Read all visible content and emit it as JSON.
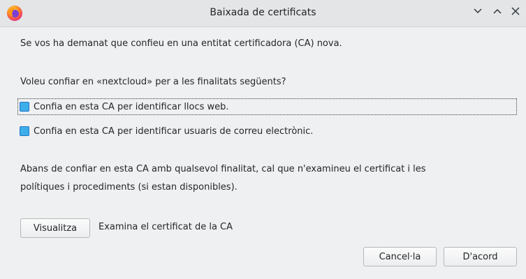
{
  "window": {
    "title": "Baixada de certificats",
    "icon": "firefox-icon",
    "controls": [
      "chevron-down-icon",
      "chevron-up-icon",
      "close-icon"
    ]
  },
  "dialog": {
    "intro": "Se vos ha demanat que confieu en una entitat certificadora (CA) nova.",
    "question": "Voleu confiar en «nextcloud» per a les finalitats següents?",
    "checkboxes": [
      {
        "label": "Confia en esta CA per identificar llocs web.",
        "checked": true
      },
      {
        "label": "Confia en esta CA per identificar usuaris de correu electrònic.",
        "checked": true
      }
    ],
    "advice": "Abans de confiar en esta CA amb qualsevol finalitat, cal que n'examineu el certificat i les",
    "advice_line2": "polítiques i procediments (si estan disponibles).",
    "view_button": "Visualitza",
    "view_description": "Examina el certificat de la CA",
    "cancel_button": "Cancel·la",
    "ok_button": "D'acord"
  }
}
